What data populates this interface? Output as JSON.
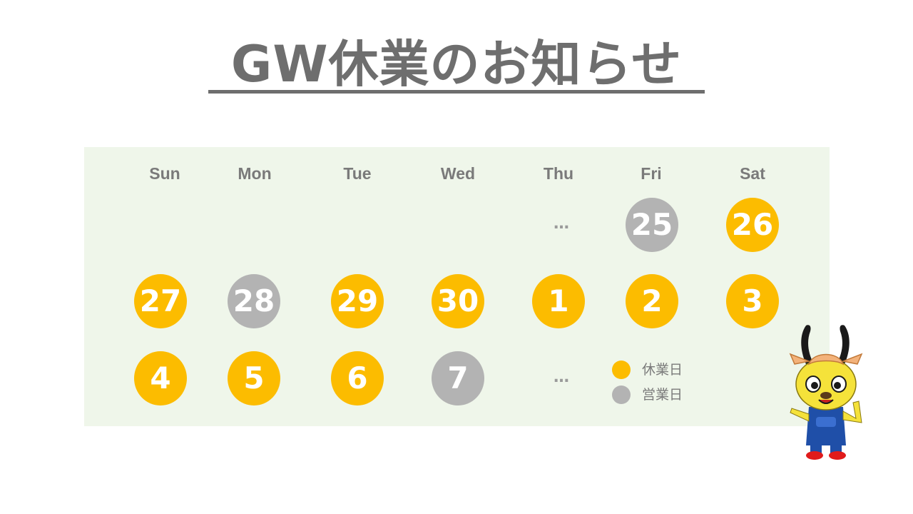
{
  "title": "GW休業のお知らせ",
  "weekdays": [
    "Sun",
    "Mon",
    "Tue",
    "Wed",
    "Thu",
    "Fri",
    "Sat"
  ],
  "ellipsis": "…",
  "colors": {
    "closed": "#fcbc00",
    "open": "#b3b3b3",
    "title": "#6e6e6e",
    "panel": "#eff6ea"
  },
  "weeks": [
    {
      "ellipsis_col": 4,
      "days": [
        {
          "col": 5,
          "label": "25",
          "status": "open"
        },
        {
          "col": 6,
          "label": "26",
          "status": "closed"
        }
      ]
    },
    {
      "days": [
        {
          "col": 0,
          "label": "27",
          "status": "closed"
        },
        {
          "col": 1,
          "label": "28",
          "status": "open"
        },
        {
          "col": 2,
          "label": "29",
          "status": "closed"
        },
        {
          "col": 3,
          "label": "30",
          "status": "closed"
        },
        {
          "col": 4,
          "label": "1",
          "status": "closed"
        },
        {
          "col": 5,
          "label": "2",
          "status": "closed"
        },
        {
          "col": 6,
          "label": "3",
          "status": "closed"
        }
      ]
    },
    {
      "ellipsis_col": 4,
      "days": [
        {
          "col": 0,
          "label": "4",
          "status": "closed"
        },
        {
          "col": 1,
          "label": "5",
          "status": "closed"
        },
        {
          "col": 2,
          "label": "6",
          "status": "closed"
        },
        {
          "col": 3,
          "label": "7",
          "status": "open"
        }
      ]
    }
  ],
  "legend": [
    {
      "label": "休業日",
      "status": "closed"
    },
    {
      "label": "営業日",
      "status": "open"
    }
  ],
  "mascot": {
    "icon": "antelope-mascot-icon"
  }
}
